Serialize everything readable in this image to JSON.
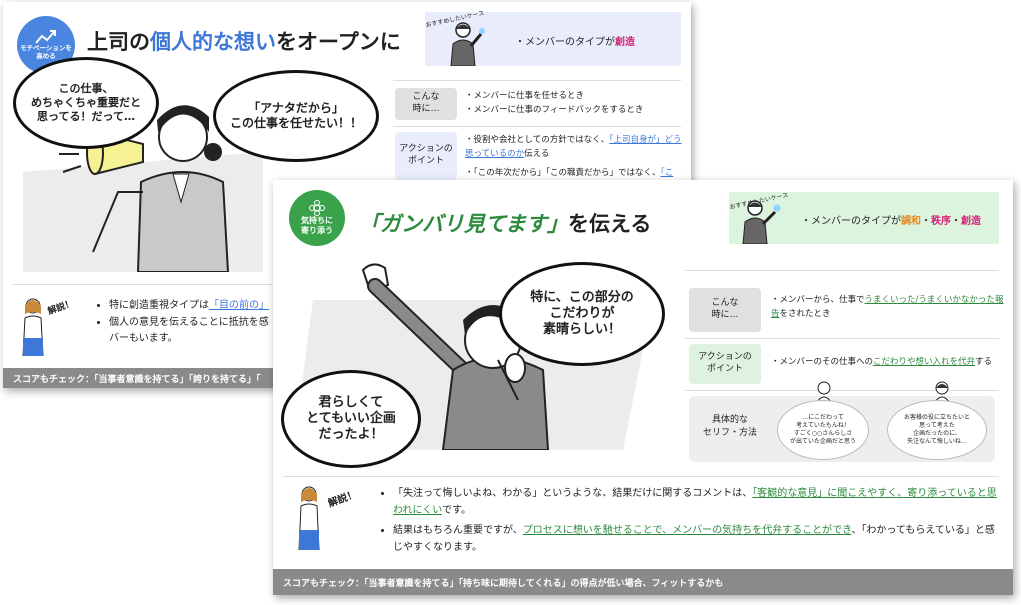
{
  "colors": {
    "blue_badge": "#4a86e0",
    "green_badge": "#39a24a",
    "footer_gray": "#8a8a8a",
    "rec_bg_blue": "#e8ecfb",
    "rec_bg_green": "#dcf4de",
    "label_gray": "#e0e0e0",
    "label_green": "#dff2e2"
  },
  "cardA": {
    "badge": [
      "モチベーションを",
      "高める"
    ],
    "title_pre": "上司の",
    "title_hl": "個人的な想い",
    "title_post": "をオープンに",
    "rec_tag": "おすすめしたいケース",
    "rec_text_pre": "・メンバーのタイプが",
    "rec_text_hl": "創造",
    "bubble1": [
      "この仕事、",
      "めちゃくちゃ重要だと",
      "思ってる！だって…"
    ],
    "bubble2": [
      "「アナタだから」",
      "この仕事を任せたい！！"
    ],
    "row1_label": [
      "こんな",
      "時に…"
    ],
    "row1_items": [
      "メンバーに仕事を任せるとき",
      "メンバーに仕事のフィードバックをするとき"
    ],
    "row2_label": [
      "アクションの",
      "ポイント"
    ],
    "row2_item1_pre": "役割や会社としての方針ではなく、",
    "row2_item1_link": "「上司自身が」どう思っているのか",
    "row2_item1_post": "伝える",
    "row2_item2_pre": "「この年次だから」「この職責だから」ではなく、",
    "row2_item2_link": "「こ",
    "bottom_tag": "解説！",
    "bottom_item1_pre": "特に創造重視タイプは",
    "bottom_item1_link": "「目の前の」",
    "bottom_item2": "個人の意見を伝えることに抵抗を感",
    "bottom_item2_cont": "バーもいます。",
    "footer": "スコアもチェック：「当事者意識を持てる」「誇りを持てる」「"
  },
  "cardB": {
    "badge": [
      "気持ちに",
      "寄り添う"
    ],
    "title_hl": "「ガンバリ見てます」",
    "title_post": "を伝える",
    "rec_tag": "おすすめしたいケース",
    "rec_text_pre": "・メンバーのタイプが",
    "rec_t1": "調和",
    "rec_dot1": "・",
    "rec_t2": "秩序",
    "rec_dot2": "・",
    "rec_t3": "創造",
    "bubble1": [
      "特に、この部分の",
      "こだわりが",
      "素晴らしい！"
    ],
    "bubble2": [
      "君らしくて",
      "とてもいい企画",
      "だったよ！"
    ],
    "row1_label": [
      "こんな",
      "時に…"
    ],
    "row1_pre": "メンバーから、仕事で",
    "row1_link": "うまくいった/うまくいかなかった報告",
    "row1_post": "をされたとき",
    "row2_label": [
      "アクションの",
      "ポイント"
    ],
    "row2_pre": "・メンバーのその仕事への",
    "row2_link": "こだわりや想い入れを代弁",
    "row2_post": "する",
    "row3_label": [
      "具体的な",
      "セリフ・方法"
    ],
    "speech1": [
      "…にこだわって",
      "考えていたもんね！",
      "すごく○○さんらしさ",
      "が出ていた企画だと思う"
    ],
    "speech2": [
      "お客様の役に立ちたいと",
      "思って考えた",
      "企画だったのに、",
      "失注なんて悔しいね…"
    ],
    "bottom_tag": "解説！",
    "b1_pre": "「失注って悔しいよね、わかる」というような、結果だけに関するコメントは、",
    "b1_link": "「客観的な意見」に聞こえやすく、寄り添っていると思われにくい",
    "b1_post": "です。",
    "b2_pre": "結果はもちろん重要ですが、",
    "b2_link": "プロセスに想いを馳せることで、メンバーの気持ちを代弁することができ",
    "b2_post": "、「わかってもらえている」と感じやすくなります。",
    "footer": "スコアもチェック：「当事者意識を持てる」「持ち味に期待してくれる」の得点が低い場合、フィットするかも"
  }
}
